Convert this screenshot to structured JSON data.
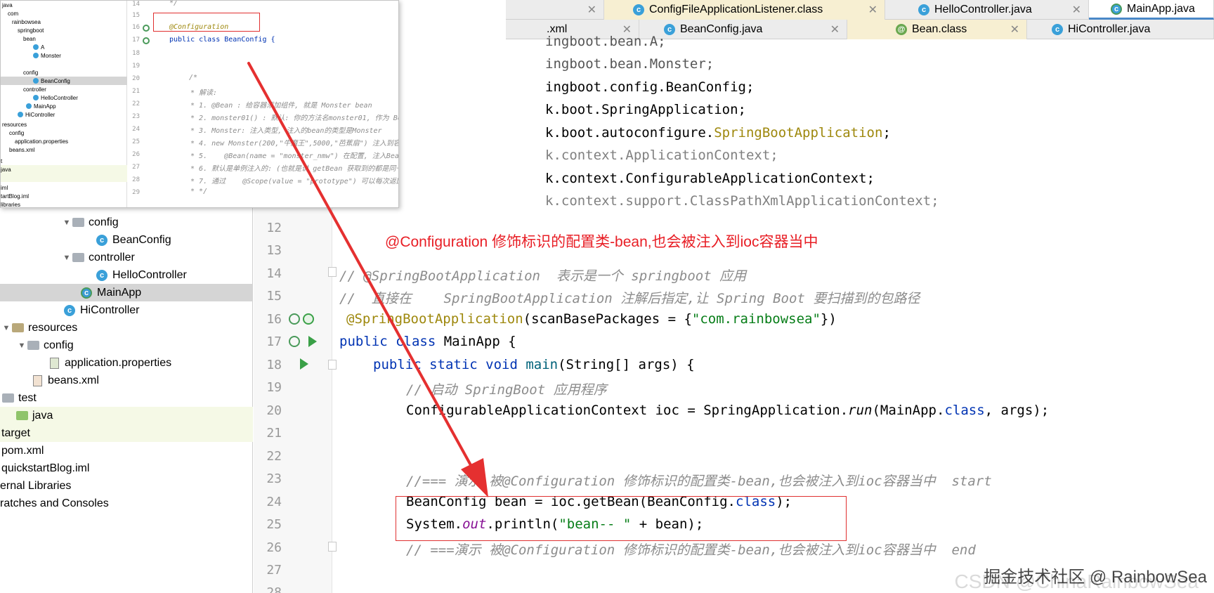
{
  "tabs_row1": [
    {
      "label": "ConfigFileApplicationListener.class"
    },
    {
      "label": "HelloController.java"
    },
    {
      "label": "MainApp.java"
    }
  ],
  "tabs_row2": [
    {
      "label": ".xml"
    },
    {
      "label": "BeanConfig.java"
    },
    {
      "label": "Bean.class"
    },
    {
      "label": "HiController.java"
    }
  ],
  "tree": {
    "items": [
      {
        "label": "config"
      },
      {
        "label": "BeanConfig"
      },
      {
        "label": "controller"
      },
      {
        "label": "HelloController"
      },
      {
        "label": "MainApp"
      },
      {
        "label": "HiController"
      },
      {
        "label": "resources"
      },
      {
        "label": "config"
      },
      {
        "label": "application.properties"
      },
      {
        "label": "beans.xml"
      },
      {
        "label": "test"
      },
      {
        "label": "java"
      },
      {
        "label": "target"
      },
      {
        "label": "pom.xml"
      },
      {
        "label": "quickstartBlog.iml"
      },
      {
        "label": "ernal Libraries"
      },
      {
        "label": "ratches and Consoles"
      }
    ]
  },
  "editor": {
    "imports": [
      "ingboot.bean.A;",
      "ingboot.bean.Monster;",
      "ingboot.config.BeanConfig;",
      "k.boot.SpringApplication;",
      "k.boot.autoconfigure.",
      "SpringBootApplication",
      ";",
      "k.context.ApplicationContext;",
      "k.context.ConfigurableApplicationContext;",
      "k.context.support.ClassPathXmlApplicationContext;"
    ],
    "line_numbers": [
      "12",
      "13",
      "14",
      "15",
      "16",
      "17",
      "18",
      "19",
      "20",
      "21",
      "22",
      "23",
      "24",
      "25",
      "26",
      "27",
      "28"
    ],
    "banner": "@Configuration 修饰标识的配置类-bean,也会被注入到ioc容器当中",
    "l14": "// @SpringBootApplication  表示是一个 springboot 应用",
    "l15": "//  直接在    SpringBootApplication 注解后指定,让 Spring Boot 要扫描到的包路径",
    "l16_ann": "@SpringBootApplication",
    "l16_a": "(scanBasePackages = {",
    "l16_str": "\"com.rainbowsea\"",
    "l16_b": "})",
    "l17_kw": "public class ",
    "l17_rest": "MainApp {",
    "l18_kw": "public static void ",
    "l18_fn": "main",
    "l18_rest": "(String[] args) {",
    "l19": "// 启动 SpringBoot 应用程序",
    "l20_a": "ConfigurableApplicationContext ioc = SpringApplication.",
    "l20_it": "run",
    "l20_b": "(MainApp.",
    "l20_kw": "class",
    "l20_c": ", args);",
    "l23": "//=== 演示 被@Configuration 修饰标识的配置类-bean,也会被注入到ioc容器当中  start",
    "l24_a": "BeanConfig bean = ioc.getBean(BeanConfig.",
    "l24_kw": "class",
    "l24_b": ");",
    "l25_a": "System.",
    "l25_it": "out",
    "l25_b": ".println(",
    "l25_str": "\"bean-- \"",
    "l25_c": " + bean);",
    "l26": "// ===演示 被@Configuration 修饰标识的配置类-bean,也会被注入到ioc容器当中  end"
  },
  "overlay": {
    "tree": [
      "java",
      "com",
      "rainbowsea",
      "springboot",
      "bean",
      "A",
      "Monster",
      "config",
      "BeanConfig",
      "controller",
      "HelloController",
      "MainApp",
      "HiController",
      "resources",
      "config",
      "application.properties",
      "beans.xml",
      "t",
      "java",
      "",
      "iml",
      "tartBlog.iml",
      "libraries"
    ],
    "line_numbers": [
      "14",
      "15",
      "16",
      "17",
      "18",
      "19",
      "20",
      "21",
      "22",
      "23",
      "24",
      "25",
      "26",
      "27",
      "28",
      "29"
    ],
    "code": [
      "*/",
      "",
      "@Configuration",
      "public class BeanConfig {",
      "",
      "",
      "/*",
      " * 解读:",
      " * 1. @Bean : 给容器添加组件, 就是 Monster bean",
      " * 2. monster01() : 默认: 你的方法名monster01, 作为 Bean 的名字/id",
      " * 3. Monster: 注入类型, 注入的bean的类型是Monster",
      " * 4. new Monster(200,\"牛魔王\",5000,\"芭蕉扇\") 注入到容器中具体的Bean 信息",
      " * 5.    @Bean(name = \"monster_nmw\") 在配置, 注入Bean指定名字/id , name是默认",
      " * 6. 默认是单例注入的: (也就是说 getBean 获取到的都是同一个对象, 共用)",
      " * 7. 通过    @Scope(value = \"prototype\") 可以每次返回一个新的对象, 多例",
      " * */"
    ]
  },
  "watermark": "掘金技术社区 @ RainbowSea",
  "watermark_bg": "CSDN @ChinaRainbowSea",
  "colors": {
    "accent_red": "#e81e25",
    "arrow_red": "#e53030",
    "keyword": "#0033b3",
    "annotation": "#9e880d"
  }
}
